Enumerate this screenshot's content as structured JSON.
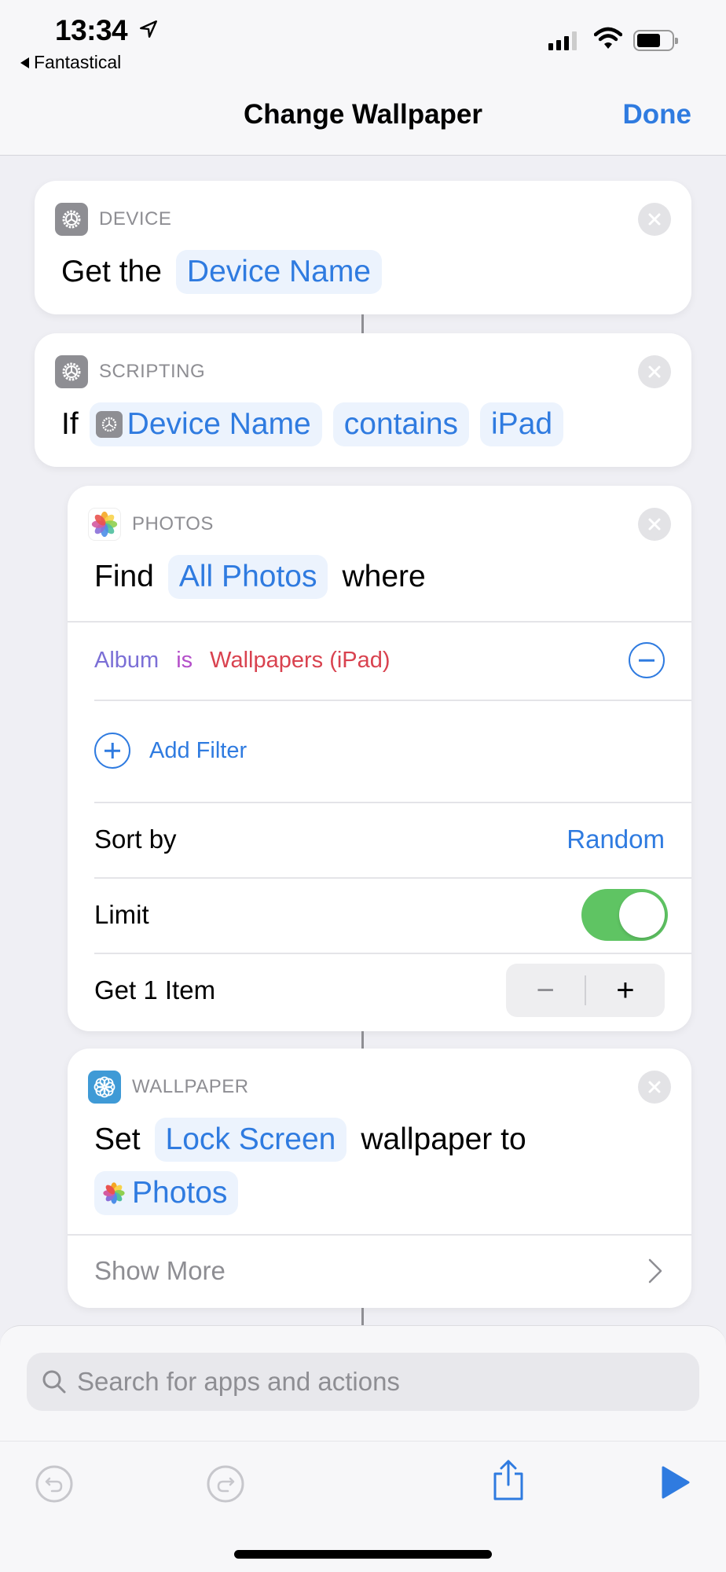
{
  "status_bar": {
    "time": "13:34",
    "location_icon": "location-arrow-icon",
    "back_app": "Fantastical",
    "icons": [
      "cellular-signal-icon",
      "wifi-icon",
      "battery-icon"
    ]
  },
  "nav": {
    "title": "Change Wallpaper",
    "done_label": "Done"
  },
  "colors": {
    "accent": "#2f7be0",
    "toggle_on": "#5fc463",
    "filter_property": "#7b6fd6",
    "filter_operator": "#b44fc9",
    "filter_value": "#d9424f"
  },
  "actions": [
    {
      "category": "DEVICE",
      "icon": "settings-gear-icon",
      "prefix": "Get the",
      "param": "Device Name"
    },
    {
      "category": "SCRIPTING",
      "icon": "settings-gear-icon",
      "prefix": "If",
      "variable": "Device Name",
      "operator": "contains",
      "value": "iPad"
    },
    {
      "category": "PHOTOS",
      "icon": "photos-icon",
      "prefix": "Find",
      "param": "All Photos",
      "suffix": "where",
      "filter": {
        "property": "Album",
        "operator": "is",
        "value": "Wallpapers (iPad)"
      },
      "add_filter_label": "Add Filter",
      "sort_by_label": "Sort by",
      "sort_by_value": "Random",
      "limit_label": "Limit",
      "limit_enabled": true,
      "get_items_label": "Get 1 Item",
      "stepper_minus": "−",
      "stepper_plus": "+"
    },
    {
      "category": "WALLPAPER",
      "icon": "wallpaper-icon",
      "prefix": "Set",
      "param": "Lock Screen",
      "middle": "wallpaper to",
      "variable": "Photos",
      "show_more_label": "Show More"
    }
  ],
  "bottom": {
    "search_placeholder": "Search for apps and actions",
    "toolbar": [
      "undo-icon",
      "redo-icon",
      "share-icon",
      "play-icon"
    ]
  }
}
